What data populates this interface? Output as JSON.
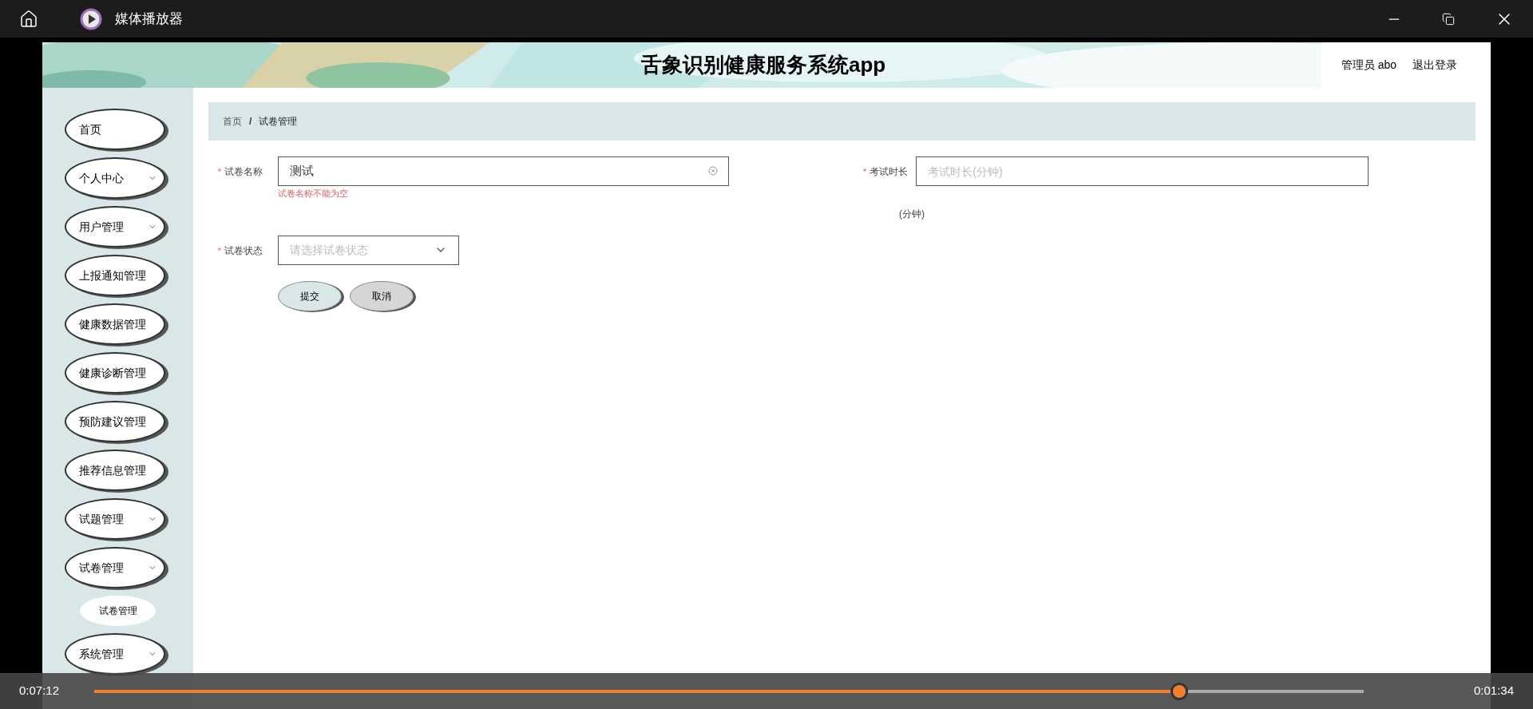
{
  "window": {
    "title": "媒体播放器"
  },
  "header": {
    "title": "舌象识别健康服务系统app",
    "user": "管理员 abo",
    "logout": "退出登录"
  },
  "sidebar": {
    "items": [
      {
        "label": "首页",
        "has_submenu": false
      },
      {
        "label": "个人中心",
        "has_submenu": true
      },
      {
        "label": "用户管理",
        "has_submenu": true
      },
      {
        "label": "上报通知管理",
        "has_submenu": false
      },
      {
        "label": "健康数据管理",
        "has_submenu": false
      },
      {
        "label": "健康诊断管理",
        "has_submenu": false
      },
      {
        "label": "预防建议管理",
        "has_submenu": false
      },
      {
        "label": "推荐信息管理",
        "has_submenu": false
      },
      {
        "label": "试题管理",
        "has_submenu": true
      },
      {
        "label": "试卷管理",
        "has_submenu": true,
        "children": [
          {
            "label": "试卷管理"
          }
        ]
      },
      {
        "label": "系统管理",
        "has_submenu": true
      }
    ]
  },
  "breadcrumb": {
    "items": [
      "首页",
      "试卷管理"
    ],
    "separator": "/"
  },
  "form": {
    "name": {
      "label": "试卷名称",
      "required_mark": "*",
      "value": "测试",
      "error": "试卷名称不能为空"
    },
    "duration": {
      "label": "考试时长",
      "required_mark": "*",
      "placeholder": "考试时长(分钟)",
      "unit": "(分钟)"
    },
    "status": {
      "label": "试卷状态",
      "required_mark": "*",
      "placeholder": "请选择试卷状态"
    },
    "buttons": [
      {
        "label": "提交",
        "kind": "primary"
      },
      {
        "label": "取消",
        "kind": "secondary"
      }
    ]
  },
  "player": {
    "elapsed": "0:07:12",
    "remaining": "0:01:34",
    "level": 0.855
  }
}
